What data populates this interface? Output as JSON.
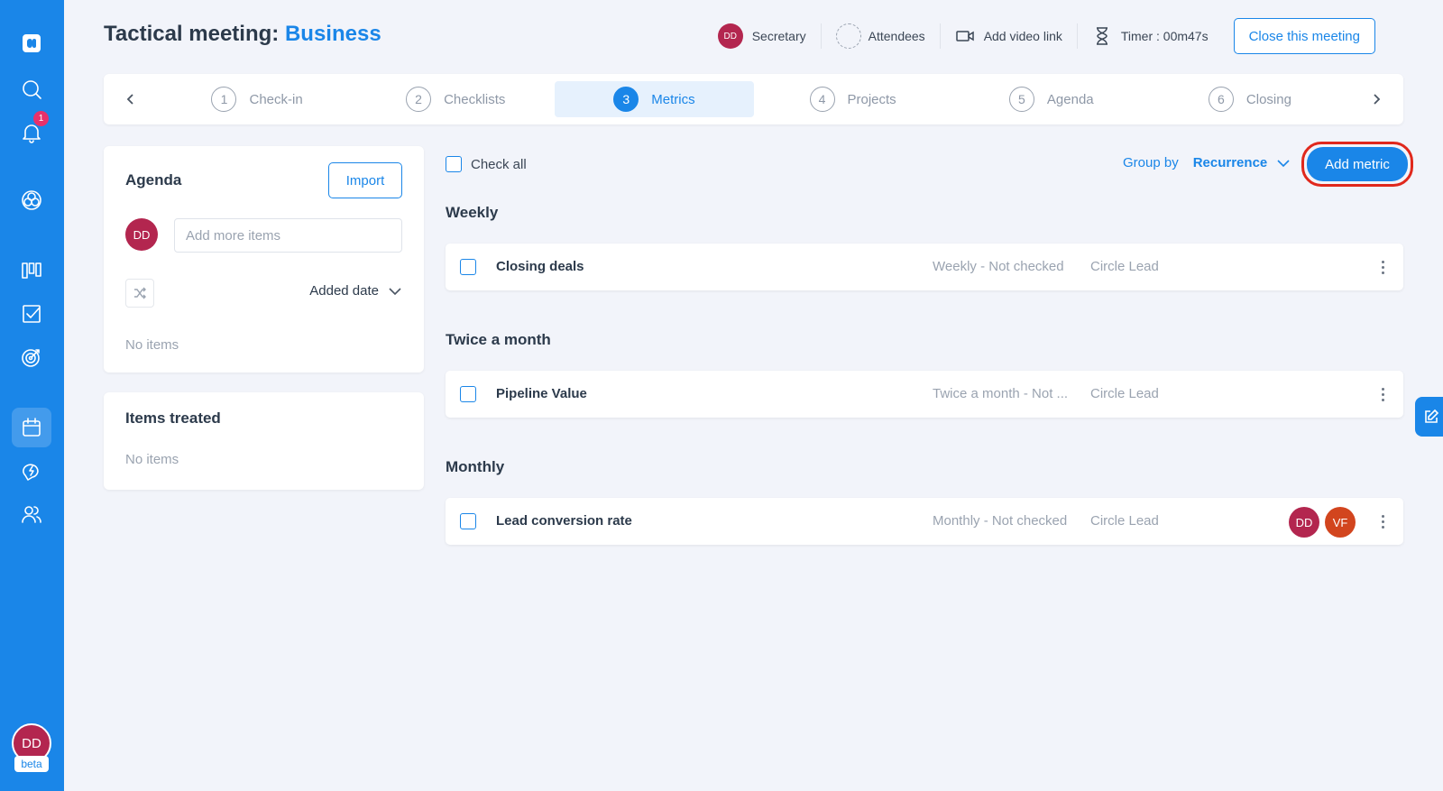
{
  "header": {
    "title_prefix": "Tactical meeting: ",
    "title_accent": "Business",
    "secretary_initials": "DD",
    "secretary_label": "Secretary",
    "attendees_label": "Attendees",
    "video_link_label": "Add video link",
    "timer_label": "Timer : 00m47s",
    "close_button": "Close this meeting"
  },
  "sidebar": {
    "notification_count": "1",
    "user_initials": "DD",
    "beta_label": "beta",
    "icons": [
      "logo-icon",
      "search-icon",
      "bell-icon",
      "network-icon",
      "board-icon",
      "checklist-icon",
      "target-icon",
      "calendar-icon",
      "lightning-chat-icon",
      "people-icon"
    ],
    "active": "calendar-icon"
  },
  "stepper": {
    "steps": [
      {
        "num": "1",
        "label": "Check-in"
      },
      {
        "num": "2",
        "label": "Checklists"
      },
      {
        "num": "3",
        "label": "Metrics"
      },
      {
        "num": "4",
        "label": "Projects"
      },
      {
        "num": "5",
        "label": "Agenda"
      },
      {
        "num": "6",
        "label": "Closing"
      }
    ],
    "active_index": 2
  },
  "agenda": {
    "title": "Agenda",
    "import_button": "Import",
    "avatar_initials": "DD",
    "input_placeholder": "Add more items",
    "sort_label": "Added date",
    "empty_text": "No items"
  },
  "items_treated": {
    "title": "Items treated",
    "empty_text": "No items"
  },
  "metrics": {
    "check_all_label": "Check all",
    "group_by_label": "Group by",
    "group_by_value": "Recurrence",
    "add_button": "Add metric",
    "groups": [
      {
        "title": "Weekly",
        "rows": [
          {
            "name": "Closing deals",
            "status": "Weekly - Not checked",
            "owner": "Circle Lead",
            "avatars": []
          }
        ]
      },
      {
        "title": "Twice a month",
        "rows": [
          {
            "name": "Pipeline Value",
            "status": "Twice a month - Not ...",
            "owner": "Circle Lead",
            "avatars": []
          }
        ]
      },
      {
        "title": "Monthly",
        "rows": [
          {
            "name": "Lead conversion rate",
            "status": "Monthly - Not checked",
            "owner": "Circle Lead",
            "avatars": [
              {
                "initials": "DD",
                "color": "#b3264f"
              },
              {
                "initials": "VF",
                "color": "#d2451e"
              }
            ]
          }
        ]
      }
    ]
  },
  "colors": {
    "accent": "#1a86e8",
    "highlight": "#e0281c",
    "avatar_dd": "#b3264f",
    "avatar_vf": "#d2451e"
  }
}
